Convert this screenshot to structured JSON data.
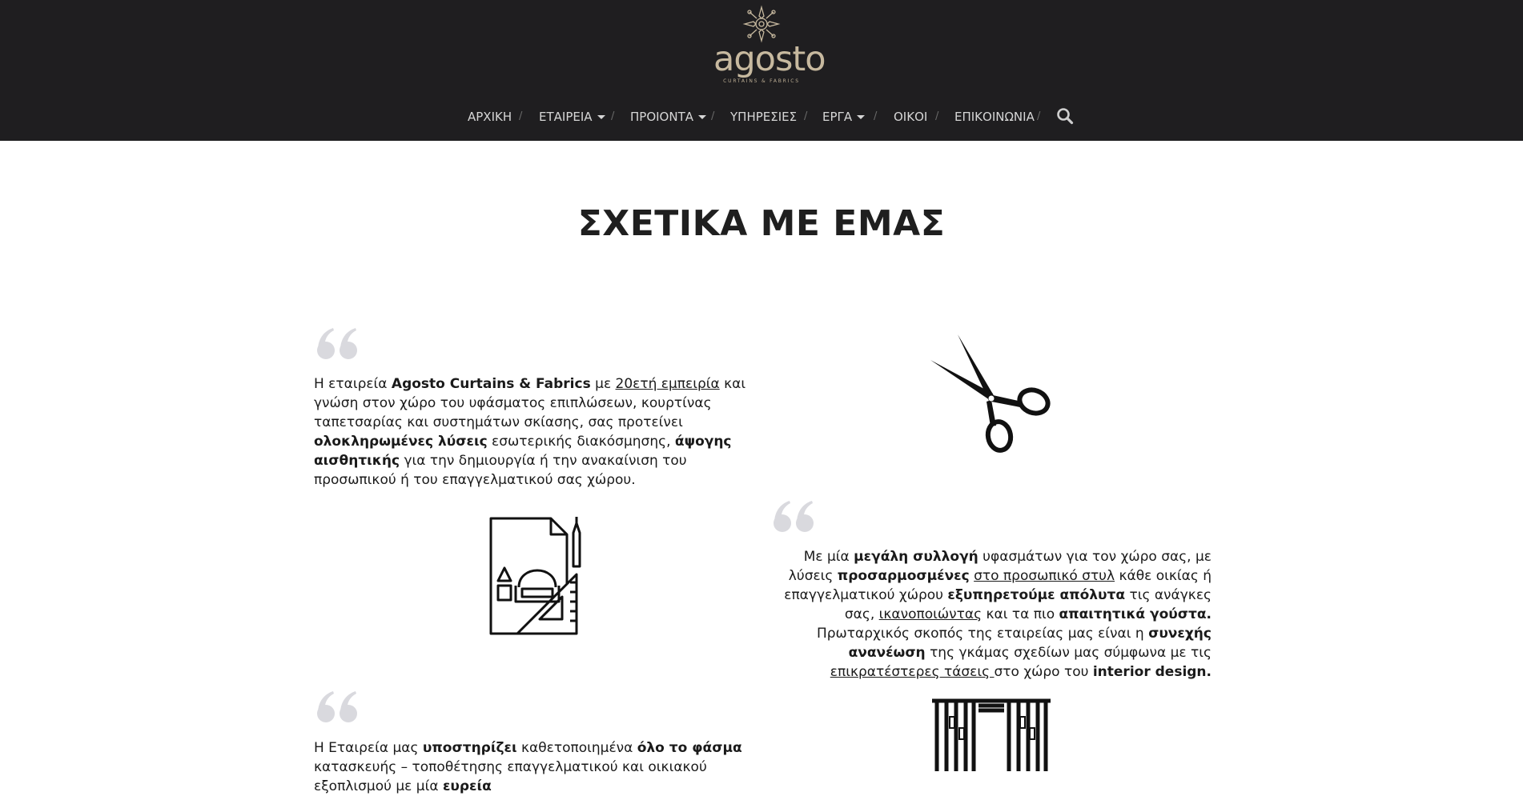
{
  "brand": {
    "name": "agosto",
    "tagline": "CURTAINS & FABRICS"
  },
  "nav": {
    "items": [
      {
        "label": "ΑΡΧΙΚΗ"
      },
      {
        "label": "ΕΤΑΙΡΕΙΑ"
      },
      {
        "label": "ΠΡΟΙΟΝΤΑ"
      },
      {
        "label": "ΥΠΗΡΕΣΙΕΣ"
      },
      {
        "label": "ΕΡΓΑ"
      },
      {
        "label": "ΟΙΚΟΙ"
      },
      {
        "label": "ΕΠΙΚΟΙΝΩΝΙΑ"
      }
    ],
    "separator": "/"
  },
  "page": {
    "title": "ΣΧΕΤΙΚΑ ΜΕ ΕΜΑΣ"
  },
  "section1": {
    "t1": "Η εταιρεία ",
    "b1": "Agosto Curtains & Fabrics",
    "t2": " με ",
    "u1": "20ετή εμπειρία",
    "t3": " και γνώση στον χώρο του υφάσματος επιπλώσεων, κουρτίνας ταπετσαρίας και συστημάτων σκίασης, σας προτείνει ",
    "b2": "ολοκληρωμένες λύσεις",
    "t4": " εσωτερικής διακόσμησης, ",
    "b3": "άψογης αισθητικής",
    "t5": " για την δημιουργία ή την ανακαίνιση του προσωπικού ή του επαγγελματικού σας χώρου."
  },
  "section2": {
    "t1": "Με μία ",
    "b1": "μεγάλη συλλογή",
    "t2": " υφασμάτων για τον χώρο σας, με λύσεις ",
    "b2": "προσαρμοσμένες",
    "t3": " ",
    "u1": "στο προσωπικό στυλ",
    "t4": " κάθε οικίας ή επαγγελματικού χώρου ",
    "b3": "εξυπηρετούμε απόλυτα",
    "t5": " τις ανάγκες σας, ",
    "u2": "ικανοποιώντας",
    "t6": " και τα πιο ",
    "b4": "απαιτητικά γούστα.",
    "t7": " Πρωταρχικός σκοπός της εταιρείας μας είναι η ",
    "b5": "συνεχής ανανέωση",
    "t8": " της γκάμας σχεδίων μας σύμφωνα με τις ",
    "u3": "επικρατέστερες τάσεις ",
    "t9": "στο χώρο του ",
    "b6": "interior design."
  },
  "section3": {
    "t1": "Η Εταιρεία μας ",
    "b1": "υποστηρίζει",
    "t2": " καθετοποιημένα ",
    "b2": "όλο το φάσμα",
    "t3": " κατασκευής – τοποθέτησης επαγγελματικού και οικιακού εξοπλισμού με μία ",
    "b3": "ευρεία"
  },
  "icons": [
    "scissors-icon",
    "interior-design-sketch-icon",
    "curtains-icon",
    "quote-mark-icon",
    "search-icon"
  ],
  "colors": {
    "header_bg": "#1f1e20",
    "brand_gold": "#c7b99f",
    "nav_text": "#d6d6d6",
    "quote_gray": "#d9d9de"
  }
}
